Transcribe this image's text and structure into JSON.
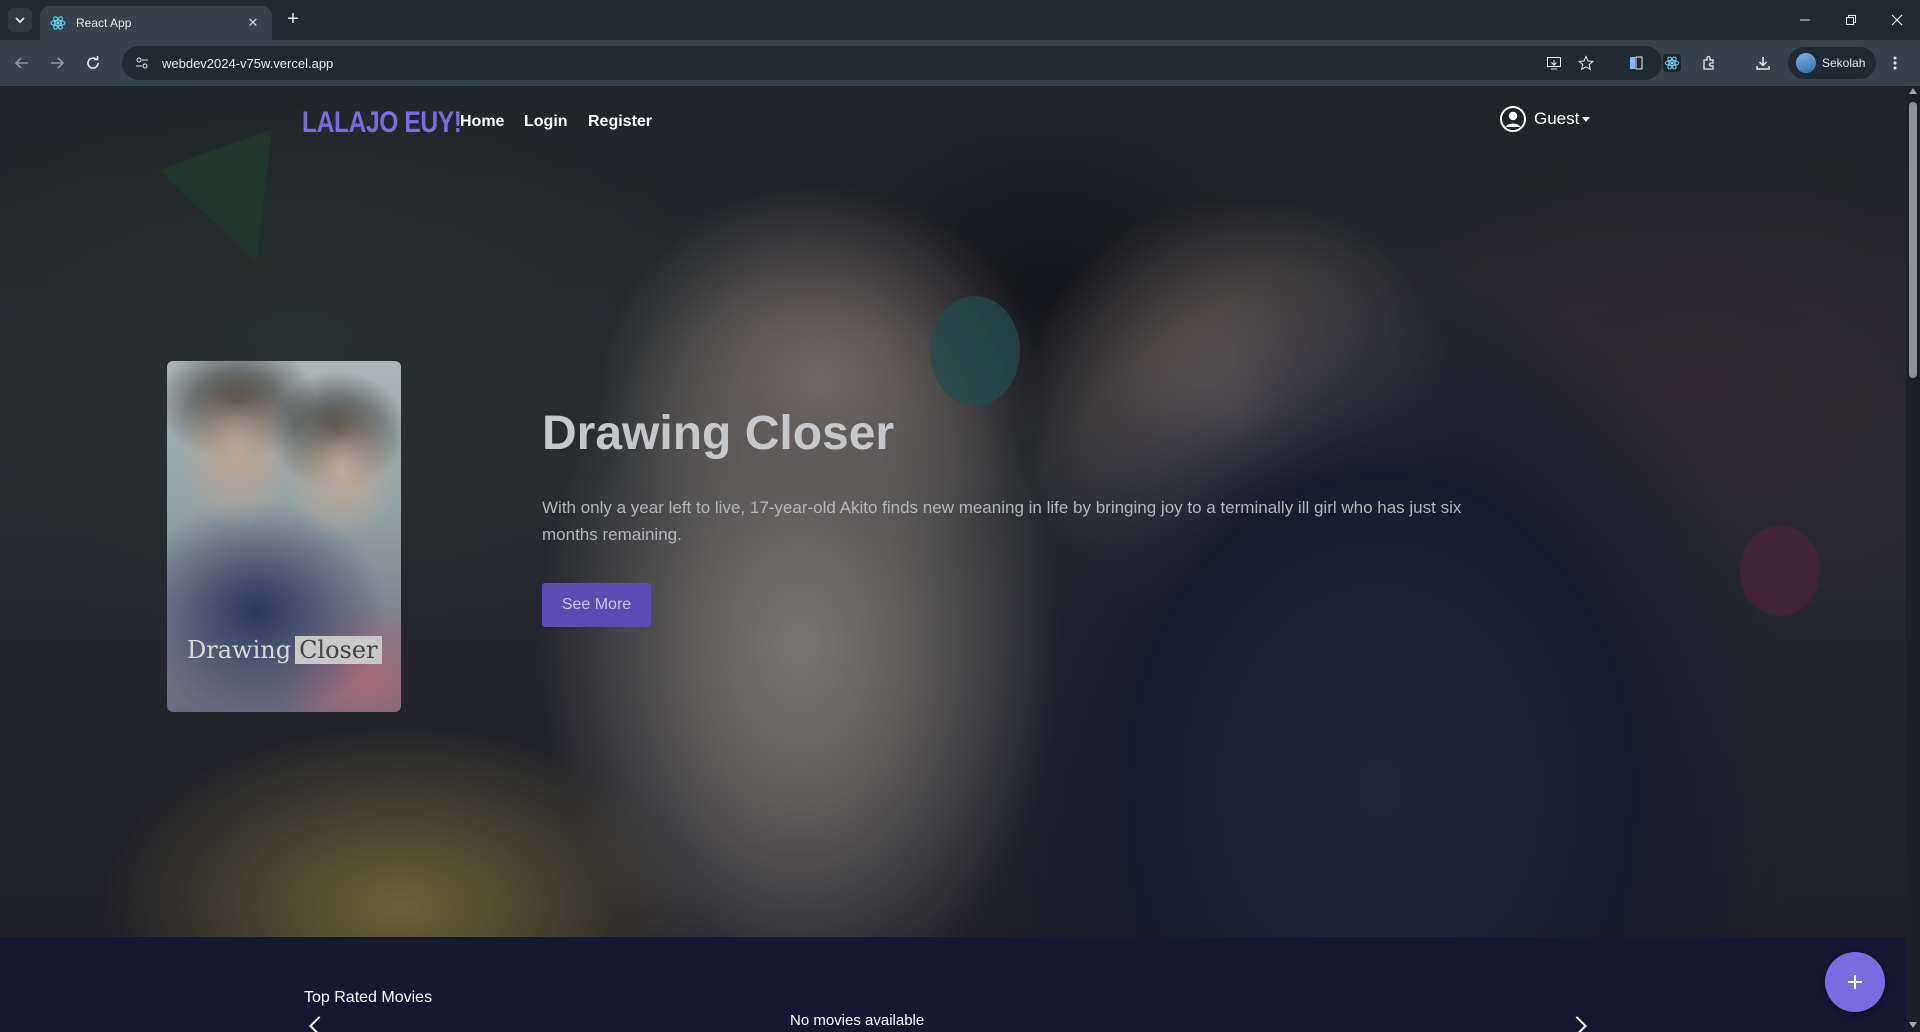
{
  "browser": {
    "tab": {
      "title": "React App",
      "favicon": "react-icon"
    },
    "url": "webdev2024-v75w.vercel.app",
    "profile_name": "Sekolah",
    "icons": [
      "tab-list-icon",
      "close-icon",
      "plus-icon",
      "minimize-icon",
      "restore-icon",
      "close-window-icon",
      "back-icon",
      "forward-icon",
      "reload-icon",
      "site-info-icon",
      "install-app-icon",
      "bookmark-star-icon",
      "reading-list-icon",
      "react-devtools-icon",
      "extensions-icon",
      "download-icon",
      "menu-icon"
    ]
  },
  "navbar": {
    "brand": "LALAJO EUY!",
    "links": [
      "Home",
      "Login",
      "Register"
    ],
    "user_label": "Guest",
    "brand_color": "#7b6be0"
  },
  "hero": {
    "title": "Drawing Closer",
    "description": "With only a year left to live, 17-year-old Akito finds new meaning in life by bringing joy to a terminally ill girl who has just six months remaining.",
    "button_label": "See More",
    "poster_title_a": "Drawing",
    "poster_title_b": "Closer"
  },
  "section": {
    "title": "Top Rated Movies",
    "empty_text": "No movies available"
  },
  "colors": {
    "accent": "#7b6be0",
    "button": "#5b4bb3",
    "page_bg": "#141832"
  }
}
